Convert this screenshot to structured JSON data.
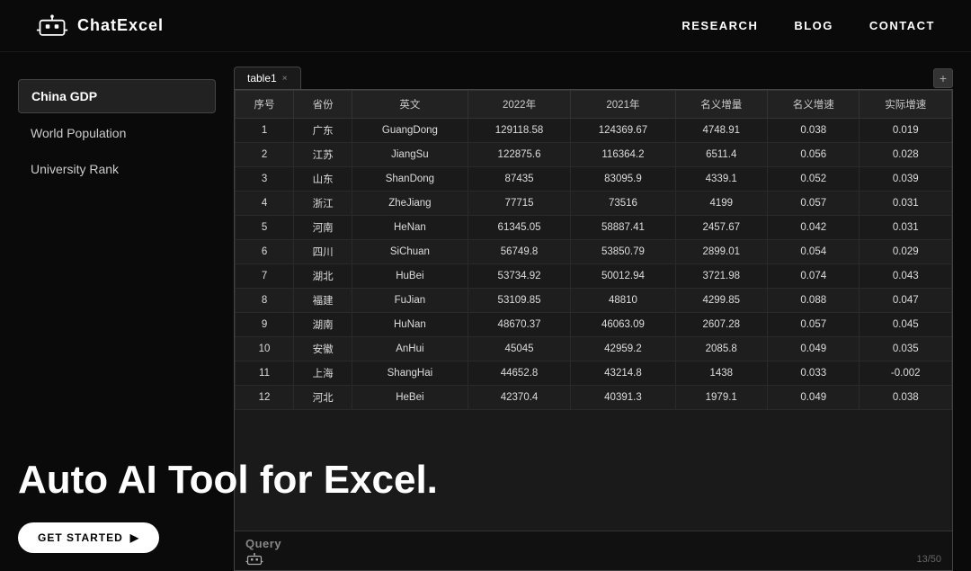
{
  "header": {
    "logo_text": "ChatExcel",
    "nav_items": [
      {
        "label": "RESEARCH",
        "id": "research"
      },
      {
        "label": "BLOG",
        "id": "blog"
      },
      {
        "label": "CONTACT",
        "id": "contact"
      }
    ]
  },
  "sidebar": {
    "items": [
      {
        "label": "China GDP",
        "active": true
      },
      {
        "label": "World Population",
        "active": false
      },
      {
        "label": "University Rank",
        "active": false
      }
    ]
  },
  "spreadsheet": {
    "tab_label": "table1",
    "columns": [
      "序号",
      "省份",
      "英文",
      "2022年",
      "2021年",
      "名义增量",
      "名义增速",
      "实际增速"
    ],
    "rows": [
      [
        "1",
        "广东",
        "GuangDong",
        "129118.58",
        "124369.67",
        "4748.91",
        "0.038",
        "0.019"
      ],
      [
        "2",
        "江苏",
        "JiangSu",
        "122875.6",
        "116364.2",
        "6511.4",
        "0.056",
        "0.028"
      ],
      [
        "3",
        "山东",
        "ShanDong",
        "87435",
        "83095.9",
        "4339.1",
        "0.052",
        "0.039"
      ],
      [
        "4",
        "浙江",
        "ZheJiang",
        "77715",
        "73516",
        "4199",
        "0.057",
        "0.031"
      ],
      [
        "5",
        "河南",
        "HeNan",
        "61345.05",
        "58887.41",
        "2457.67",
        "0.042",
        "0.031"
      ],
      [
        "6",
        "四川",
        "SiChuan",
        "56749.8",
        "53850.79",
        "2899.01",
        "0.054",
        "0.029"
      ],
      [
        "7",
        "湖北",
        "HuBei",
        "53734.92",
        "50012.94",
        "3721.98",
        "0.074",
        "0.043"
      ],
      [
        "8",
        "福建",
        "FuJian",
        "53109.85",
        "48810",
        "4299.85",
        "0.088",
        "0.047"
      ],
      [
        "9",
        "湖南",
        "HuNan",
        "48670.37",
        "46063.09",
        "2607.28",
        "0.057",
        "0.045"
      ],
      [
        "10",
        "安徽",
        "AnHui",
        "45045",
        "42959.2",
        "2085.8",
        "0.049",
        "0.035"
      ],
      [
        "11",
        "上海",
        "ShangHai",
        "44652.8",
        "43214.8",
        "1438",
        "0.033",
        "-0.002"
      ],
      [
        "12",
        "河北",
        "HeBei",
        "42370.4",
        "40391.3",
        "1979.1",
        "0.049",
        "0.038"
      ]
    ],
    "query_label": "Query",
    "query_count": "13/50"
  },
  "hero": {
    "title": "Auto AI Tool for Excel.",
    "cta_button": "GET STARTED"
  }
}
